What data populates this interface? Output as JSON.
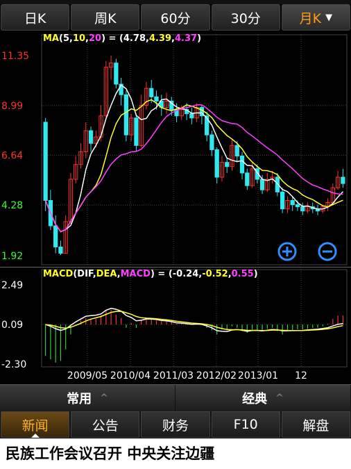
{
  "period_tabs": [
    {
      "label": "日K",
      "active": false
    },
    {
      "label": "周K",
      "active": false
    },
    {
      "label": "60分",
      "active": false
    },
    {
      "label": "30分",
      "active": false
    },
    {
      "label": "月K",
      "active": true
    }
  ],
  "dropdown_glyph": "▼",
  "ma_legend": {
    "prefix": "MA",
    "p1": "5",
    "p2": "10",
    "p3": "20",
    "v1": "4.78",
    "v2": "4.39",
    "v3": "4.37"
  },
  "price_axis": [
    "11.35",
    "8.99",
    "6.64",
    "4.28",
    "1.92"
  ],
  "macd_legend": {
    "prefix": "MACD",
    "dif": "DIF",
    "dea": "DEA",
    "macd": "MACD",
    "v1": "-0.24",
    "v2": "-0.52",
    "v3": "0.55"
  },
  "macd_axis": [
    "2.49",
    "0.09",
    "-2.30"
  ],
  "time_axis": [
    "2009/05",
    "2010/04",
    "2011/03",
    "2012/02",
    "2013/01",
    "12"
  ],
  "zoom": {
    "in": "zoom-in-icon",
    "out": "zoom-out-icon"
  },
  "bottom_menu": {
    "left": "常用",
    "right": "经典",
    "up_glyph": "^"
  },
  "info_tabs": [
    {
      "label": "新闻",
      "active": true
    },
    {
      "label": "公告",
      "active": false
    },
    {
      "label": "财务",
      "active": false
    },
    {
      "label": "F10",
      "active": false
    },
    {
      "label": "解盘",
      "active": false
    }
  ],
  "news_headline": "民族工作会议召开 中央关注边疆",
  "colors": {
    "up": "#ff3030",
    "down": "#30e8f0",
    "ma5": "#ffffff",
    "ma10": "#ffff30",
    "ma20": "#ff40ff",
    "grid": "#444444"
  },
  "chart_data": {
    "type": "candlestick",
    "price_range": [
      1.92,
      11.35
    ],
    "macd_range": [
      -2.3,
      2.49
    ],
    "candles": [
      [
        8.2,
        4.5,
        8.4,
        4.0
      ],
      [
        4.5,
        3.3,
        5.0,
        3.1
      ],
      [
        3.3,
        2.3,
        3.8,
        2.0
      ],
      [
        2.3,
        2.0,
        2.6,
        1.92
      ],
      [
        2.0,
        3.5,
        3.8,
        2.0
      ],
      [
        3.5,
        5.5,
        5.8,
        3.4
      ],
      [
        5.5,
        6.2,
        6.6,
        5.3
      ],
      [
        6.2,
        6.8,
        7.2,
        6.0
      ],
      [
        6.8,
        7.8,
        8.2,
        6.5
      ],
      [
        7.8,
        7.2,
        8.0,
        6.8
      ],
      [
        7.2,
        7.5,
        7.8,
        7.0
      ],
      [
        7.5,
        8.5,
        9.0,
        7.3
      ],
      [
        8.5,
        10.8,
        11.1,
        8.4
      ],
      [
        10.8,
        11.0,
        11.35,
        10.2
      ],
      [
        11.0,
        10.0,
        11.2,
        9.8
      ],
      [
        10.0,
        9.5,
        10.3,
        9.0
      ],
      [
        9.5,
        7.6,
        9.7,
        7.3
      ],
      [
        7.6,
        8.4,
        8.6,
        7.3
      ],
      [
        8.4,
        7.1,
        8.6,
        6.8
      ],
      [
        7.1,
        9.0,
        9.5,
        7.0
      ],
      [
        9.0,
        9.8,
        10.1,
        8.8
      ],
      [
        9.8,
        9.4,
        10.2,
        9.1
      ],
      [
        9.4,
        9.2,
        9.7,
        8.8
      ],
      [
        9.2,
        8.9,
        9.5,
        8.5
      ],
      [
        8.9,
        9.2,
        9.6,
        8.6
      ],
      [
        9.2,
        8.8,
        9.4,
        8.5
      ],
      [
        8.8,
        8.5,
        9.1,
        8.2
      ],
      [
        8.5,
        8.8,
        9.0,
        8.3
      ],
      [
        8.8,
        8.6,
        9.1,
        8.3
      ],
      [
        8.6,
        8.4,
        8.9,
        8.1
      ],
      [
        8.4,
        8.9,
        9.1,
        8.2
      ],
      [
        8.9,
        8.5,
        9.0,
        8.1
      ],
      [
        8.5,
        7.6,
        8.7,
        7.3
      ],
      [
        7.6,
        6.9,
        7.8,
        6.6
      ],
      [
        6.9,
        5.6,
        7.0,
        5.3
      ],
      [
        5.6,
        6.3,
        6.6,
        5.4
      ],
      [
        6.3,
        6.1,
        6.5,
        5.8
      ],
      [
        6.1,
        7.1,
        7.4,
        5.9
      ],
      [
        7.1,
        6.6,
        7.3,
        6.3
      ],
      [
        6.6,
        5.8,
        6.8,
        5.5
      ],
      [
        5.8,
        5.2,
        6.0,
        5.0
      ],
      [
        5.2,
        6.0,
        6.3,
        5.1
      ],
      [
        6.0,
        5.5,
        6.2,
        5.3
      ],
      [
        5.5,
        5.0,
        5.7,
        4.8
      ],
      [
        5.0,
        5.5,
        5.8,
        4.9
      ],
      [
        5.5,
        5.6,
        5.9,
        5.3
      ],
      [
        5.6,
        4.9,
        5.8,
        4.7
      ],
      [
        4.9,
        4.1,
        5.1,
        3.9
      ],
      [
        4.1,
        4.5,
        4.7,
        3.9
      ],
      [
        4.5,
        4.3,
        4.7,
        4.0
      ],
      [
        4.3,
        4.2,
        4.5,
        4.0
      ],
      [
        4.2,
        4.0,
        4.4,
        3.8
      ],
      [
        4.0,
        4.2,
        4.4,
        3.9
      ],
      [
        4.2,
        4.1,
        4.4,
        3.9
      ],
      [
        4.1,
        4.0,
        4.3,
        3.8
      ],
      [
        4.0,
        4.2,
        4.3,
        3.9
      ],
      [
        4.2,
        4.4,
        4.6,
        4.0
      ],
      [
        4.4,
        5.1,
        5.3,
        4.3
      ],
      [
        5.1,
        5.6,
        5.9,
        5.0
      ],
      [
        5.6,
        5.3,
        6.0,
        5.1
      ]
    ],
    "macd_hist": [
      -1.9,
      -2.1,
      -2.3,
      -2.2,
      -1.5,
      -0.6,
      0.0,
      0.25,
      0.4,
      0.3,
      0.35,
      0.55,
      0.85,
      0.9,
      0.6,
      0.4,
      -0.2,
      0.1,
      -0.2,
      0.25,
      0.35,
      0.3,
      0.25,
      0.2,
      0.2,
      0.15,
      0.05,
      0.1,
      0.05,
      0.0,
      0.1,
      0.05,
      -0.2,
      -0.35,
      -0.6,
      -0.3,
      -0.35,
      -0.1,
      -0.2,
      -0.4,
      -0.5,
      -0.3,
      -0.35,
      -0.4,
      -0.25,
      -0.2,
      -0.4,
      -0.6,
      -0.4,
      -0.35,
      -0.3,
      -0.3,
      -0.25,
      -0.2,
      -0.2,
      -0.1,
      0.05,
      0.35,
      0.55,
      0.55
    ]
  }
}
